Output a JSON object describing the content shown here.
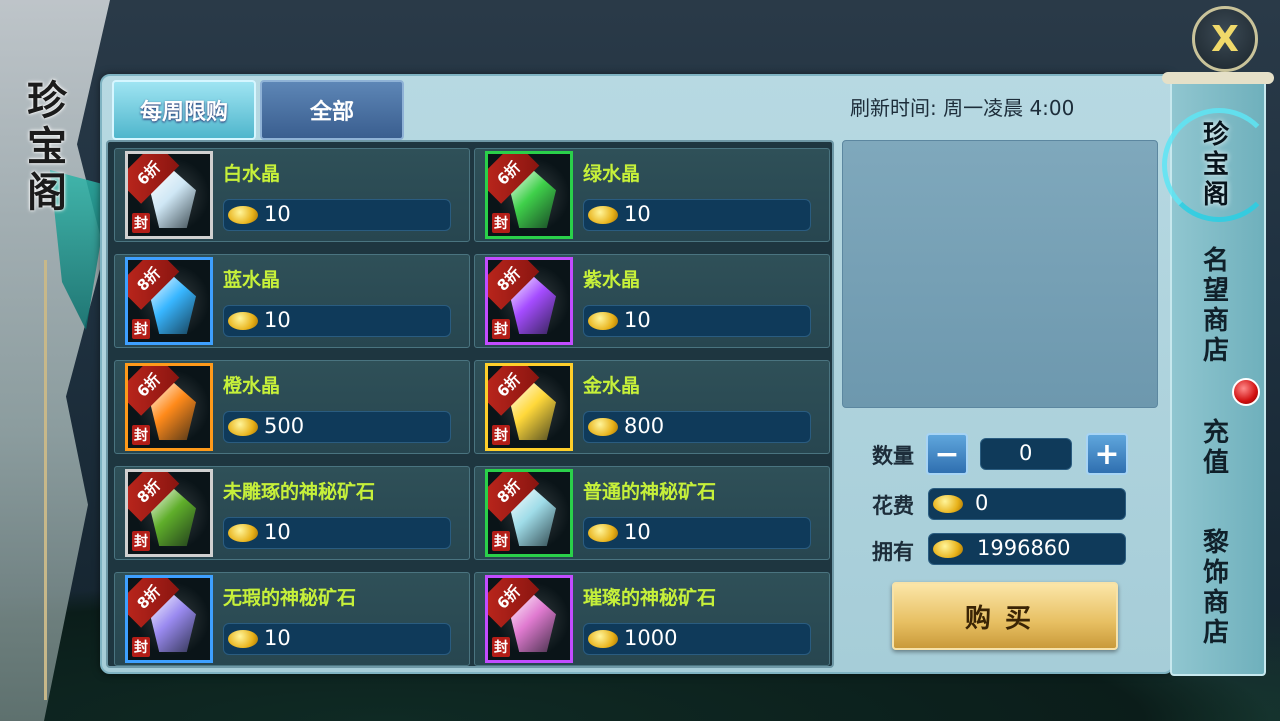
{
  "title": "珍宝阁",
  "tabs": [
    {
      "label": "每周限购",
      "active": true
    },
    {
      "label": "全部",
      "active": false
    }
  ],
  "refresh_text": "刷新时间:  周一凌晨 4:00",
  "items": [
    {
      "name": "白水晶",
      "price": "10",
      "discount": "6折",
      "seal": "封",
      "rarity": "white",
      "gem_color": "#cfe7f5"
    },
    {
      "name": "绿水晶",
      "price": "10",
      "discount": "6折",
      "seal": "封",
      "rarity": "green",
      "gem_color": "#3fd04a"
    },
    {
      "name": "蓝水晶",
      "price": "10",
      "discount": "8折",
      "seal": "封",
      "rarity": "blue",
      "gem_color": "#38b6ff"
    },
    {
      "name": "紫水晶",
      "price": "10",
      "discount": "8折",
      "seal": "封",
      "rarity": "purple",
      "gem_color": "#a54cff"
    },
    {
      "name": "橙水晶",
      "price": "500",
      "discount": "6折",
      "seal": "封",
      "rarity": "orange",
      "gem_color": "#ff8a1a"
    },
    {
      "name": "金水晶",
      "price": "800",
      "discount": "6折",
      "seal": "封",
      "rarity": "gold",
      "gem_color": "#ffd83a"
    },
    {
      "name": "未雕琢的神秘矿石",
      "price": "10",
      "discount": "8折",
      "seal": "封",
      "rarity": "white",
      "gem_color": "#5fae2a"
    },
    {
      "name": "普通的神秘矿石",
      "price": "10",
      "discount": "8折",
      "seal": "封",
      "rarity": "green",
      "gem_color": "#9fdce8"
    },
    {
      "name": "无瑕的神秘矿石",
      "price": "10",
      "discount": "8折",
      "seal": "封",
      "rarity": "blue",
      "gem_color": "#9a8af0"
    },
    {
      "name": "璀璨的神秘矿石",
      "price": "1000",
      "discount": "6折",
      "seal": "封",
      "rarity": "purple",
      "gem_color": "#e07ad0"
    }
  ],
  "purchase": {
    "quantity_label": "数量",
    "quantity_value": "0",
    "minus": "−",
    "plus": "+",
    "cost_label": "花费",
    "cost_value": "0",
    "owned_label": "拥有",
    "owned_value": "1996860",
    "buy_label": "购买"
  },
  "side_tabs": [
    {
      "label": "珍宝阁",
      "active": true
    },
    {
      "label": "名望商店",
      "active": false
    },
    {
      "label": "充值",
      "active": false
    },
    {
      "label": "黎饰商店",
      "active": false
    }
  ],
  "close_label": "X"
}
